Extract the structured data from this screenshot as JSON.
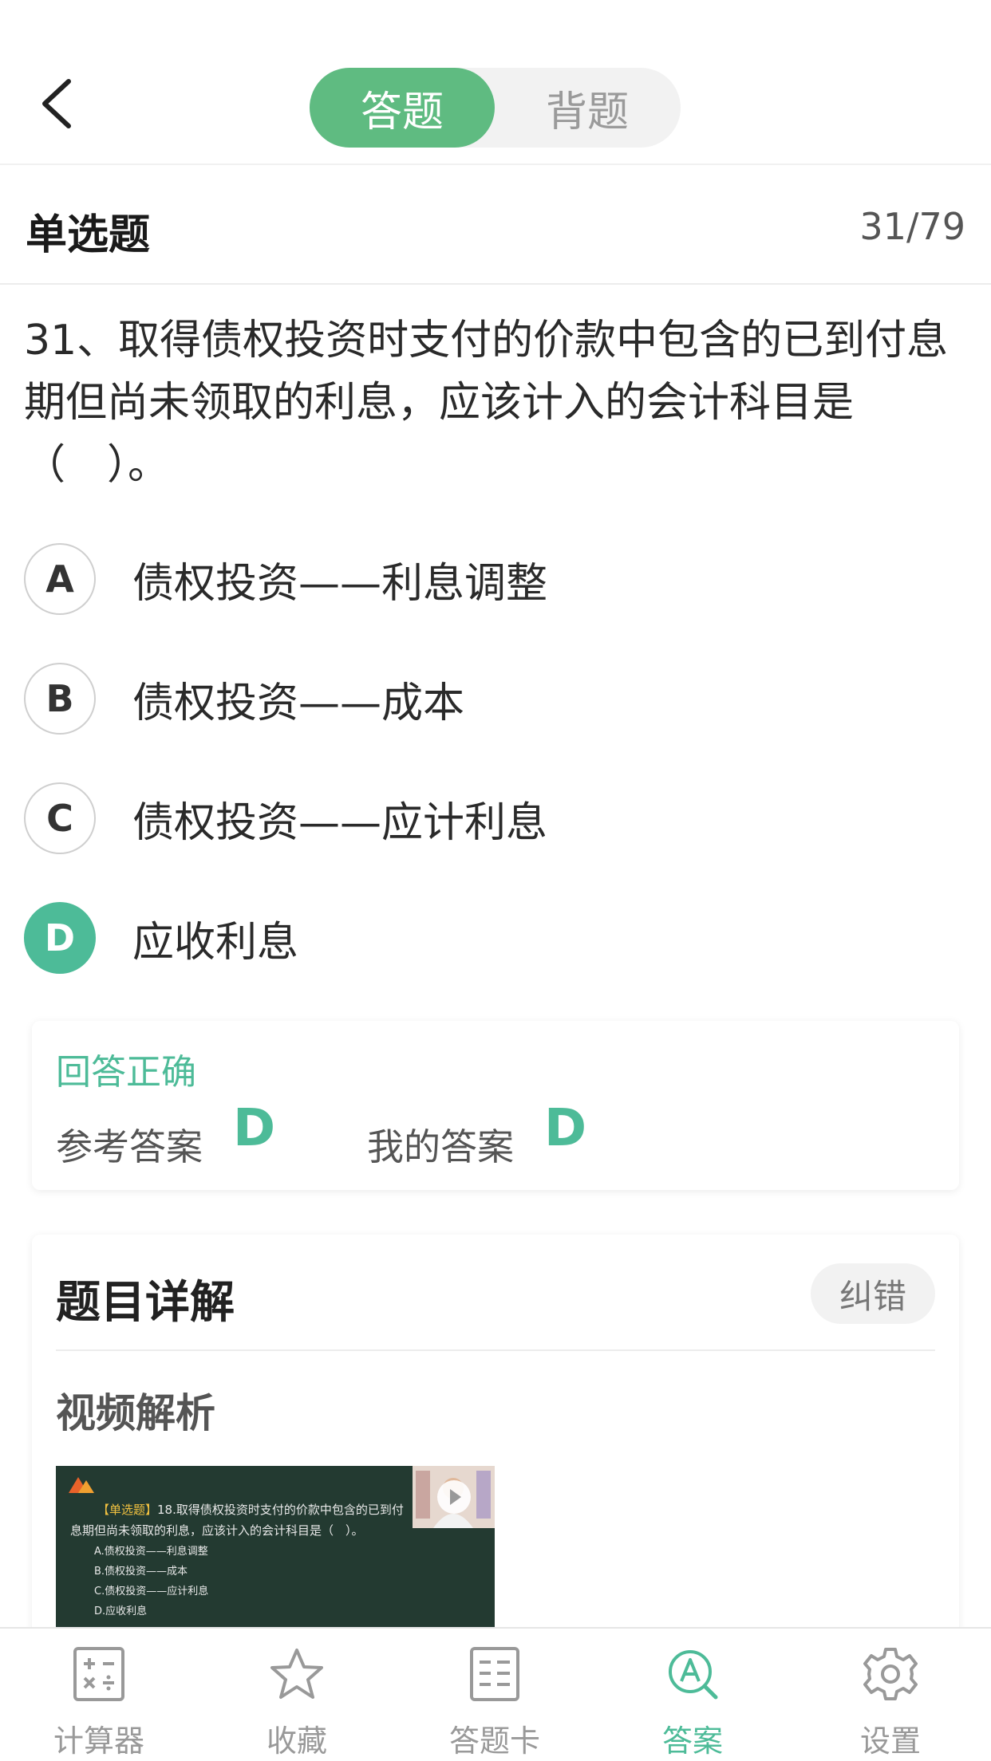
{
  "header": {
    "tabs": [
      {
        "label": "答题",
        "active": true
      },
      {
        "label": "背题",
        "active": false
      }
    ]
  },
  "question_meta": {
    "type": "单选题",
    "counter": "31/79"
  },
  "question": {
    "text": "31、取得债权投资时支付的价款中包含的已到付息期但尚未领取的利息，应该计入的会计科目是（　）。",
    "options": [
      {
        "letter": "A",
        "text": "债权投资——利息调整",
        "selected": false
      },
      {
        "letter": "B",
        "text": "债权投资——成本",
        "selected": false
      },
      {
        "letter": "C",
        "text": "债权投资——应计利息",
        "selected": false
      },
      {
        "letter": "D",
        "text": "应收利息",
        "selected": true
      }
    ]
  },
  "result": {
    "status": "回答正确",
    "reference_label": "参考答案",
    "reference_value": "D",
    "my_label": "我的答案",
    "my_value": "D"
  },
  "detail": {
    "title": "题目详解",
    "report_button": "纠错",
    "video_title": "视频解析",
    "video_thumbnail": {
      "line1_tag": "【单选题】",
      "line1_text": "18.取得债权投资时支付的价款中包含的已到付",
      "line2": "息期但尚未领取的利息，应该计入的会计科目是（　）。",
      "options": [
        "A.债权投资——利息调整",
        "B.债权投资——成本",
        "C.债权投资——应计利息",
        "D.应收利息"
      ]
    }
  },
  "tabbar": {
    "items": [
      {
        "label": "计算器",
        "icon": "calculator-icon",
        "active": false
      },
      {
        "label": "收藏",
        "icon": "star-icon",
        "active": false
      },
      {
        "label": "答题卡",
        "icon": "answer-sheet-icon",
        "active": false
      },
      {
        "label": "答案",
        "icon": "answer-search-icon",
        "active": true
      },
      {
        "label": "设置",
        "icon": "settings-icon",
        "active": false
      }
    ]
  },
  "colors": {
    "accent": "#5fbb81",
    "correct": "#4dbb98"
  }
}
